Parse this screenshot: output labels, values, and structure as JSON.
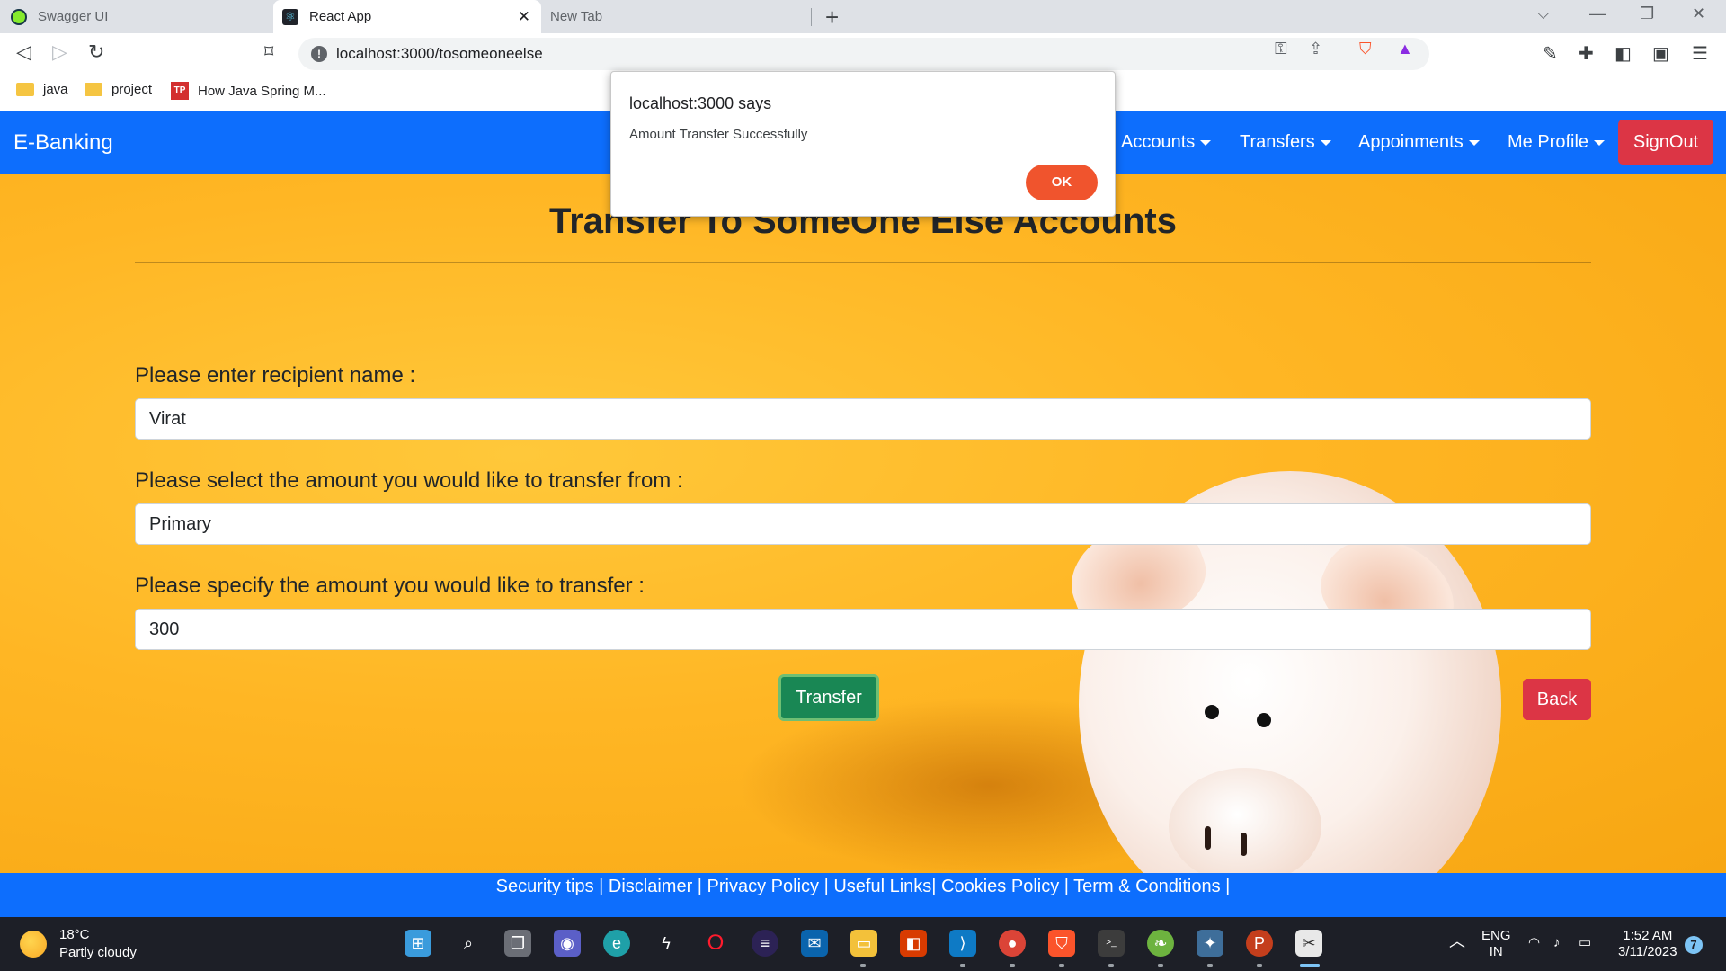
{
  "browser": {
    "tabs": [
      {
        "title": "Swagger UI",
        "icon": "swagger-icon",
        "active": false
      },
      {
        "title": "React App",
        "icon": "react-icon",
        "active": true
      },
      {
        "title": "New Tab",
        "icon": "",
        "active": false
      }
    ],
    "new_tab_symbol": "+",
    "url": "localhost:3000/tosomeoneelse",
    "bookmarks": [
      {
        "label": "java",
        "icon": "folder-icon"
      },
      {
        "label": "project",
        "icon": "folder-icon"
      },
      {
        "label": "How Java Spring M...",
        "icon": "tp-icon",
        "badge": "TP"
      }
    ]
  },
  "nav": {
    "brand": "E-Banking",
    "items": [
      {
        "label": "Accounts"
      },
      {
        "label": "Transfers"
      },
      {
        "label": "Appoinments"
      },
      {
        "label": "Me Profile"
      }
    ],
    "signout": "SignOut"
  },
  "page": {
    "title": "Transfer To SomeOne Else Accounts",
    "recipient_label": "Please enter recipient name :",
    "recipient_value": "Virat",
    "from_label": "Please select the amount you would like to transfer from :",
    "from_value": "Primary",
    "amount_label": "Please specify the amount you would like to transfer :",
    "amount_value": "300",
    "transfer_button": "Transfer",
    "back_button": "Back"
  },
  "footer": {
    "links": [
      "Security tips",
      "Disclaimer",
      "Privacy Policy",
      "Useful Links",
      "Cookies Policy",
      "Term & Conditions"
    ],
    "separators": [
      " | ",
      " | ",
      " | ",
      "| ",
      " | ",
      " |"
    ]
  },
  "dialog": {
    "origin": "localhost:3000 says",
    "message": "Amount Transfer Successfully",
    "ok": "OK"
  },
  "taskbar": {
    "temperature": "18°C",
    "weather": "Partly cloudy",
    "language": "ENG",
    "region": "IN",
    "time": "1:52 AM",
    "date": "3/11/2023",
    "notifications": "7"
  },
  "colors": {
    "primary": "#0d6efd",
    "danger": "#dc3545",
    "success": "#198754",
    "dialog_ok": "#f0542d",
    "background": "#ffb624"
  }
}
